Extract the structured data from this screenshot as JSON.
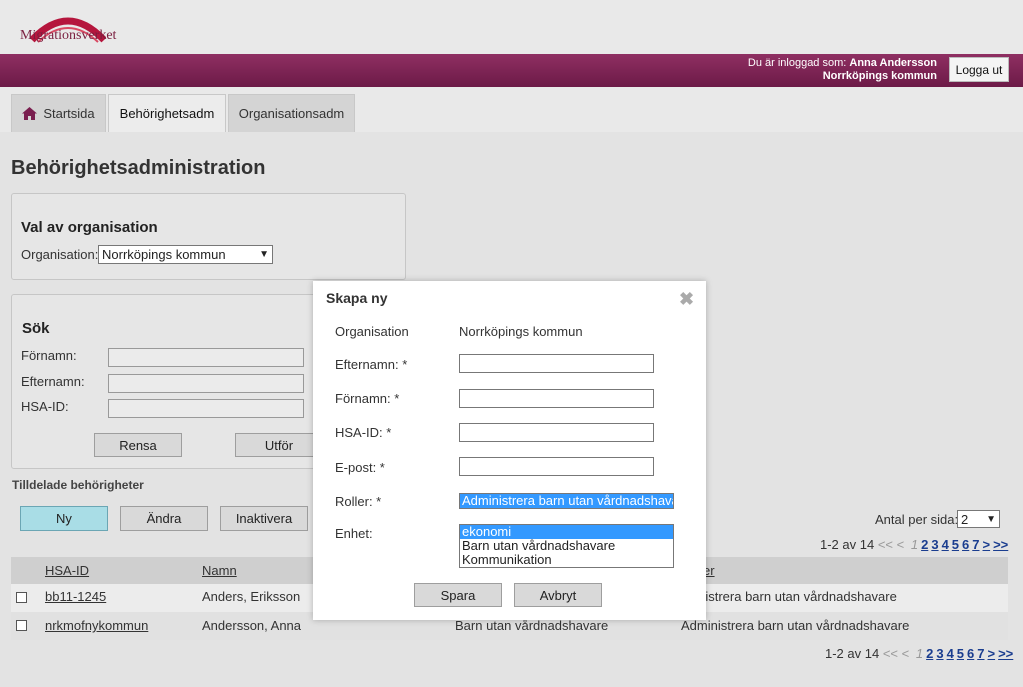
{
  "header": {
    "logo_text": "Migrationsverket",
    "logged_in_prefix": "Du är inloggad som:",
    "user_name": "Anna Andersson",
    "user_org": "Norrköpings kommun",
    "logout_label": "Logga ut"
  },
  "tabs": [
    {
      "label": "Startsida",
      "icon": "home-icon"
    },
    {
      "label": "Behörighetsadm"
    },
    {
      "label": "Organisationsadm"
    }
  ],
  "page_title": "Behörighetsadministration",
  "org_box": {
    "title": "Val av organisation",
    "label": "Organisation:",
    "selected": "Norrköpings kommun"
  },
  "search_box": {
    "title": "Sök",
    "fields": [
      {
        "label": "Förnamn:",
        "value": ""
      },
      {
        "label": "Efternamn:",
        "value": ""
      },
      {
        "label": "HSA-ID:",
        "value": ""
      }
    ],
    "clear_label": "Rensa",
    "execute_label": "Utför"
  },
  "assigned": {
    "title": "Tilldelade behörigheter",
    "new_label": "Ny",
    "edit_label": "Ändra",
    "deactivate_label": "Inaktivera",
    "per_page_label": "Antal per sida:",
    "per_page_value": "2"
  },
  "pager": {
    "range": "1-2 av 14",
    "first": "<<",
    "prev": "<",
    "current": "1",
    "pages": [
      "2",
      "3",
      "4",
      "5",
      "6",
      "7"
    ],
    "next": ">",
    "last": ">>"
  },
  "table": {
    "columns": [
      "HSA-ID",
      "Namn",
      "",
      "er"
    ],
    "rows": [
      {
        "hsa_id": "bb11-1245",
        "name": "Anders, Eriksson",
        "unit": "",
        "role": "ninistrera barn utan vårdnadshavare"
      },
      {
        "hsa_id": "nrkmofnykommun",
        "name": "Andersson, Anna",
        "unit": "Barn utan vårdnadshavare",
        "role": "Administrera barn utan vårdnadshavare"
      }
    ]
  },
  "modal": {
    "title": "Skapa ny",
    "org_label": "Organisation",
    "org_value": "Norrköpings kommun",
    "lastname_label": "Efternamn: *",
    "firstname_label": "Förnamn: *",
    "hsaid_label": "HSA-ID: *",
    "email_label": "E-post: *",
    "roles_label": "Roller: *",
    "roles_selected": "Administrera barn utan vårdnadshavare",
    "unit_label": "Enhet:",
    "unit_options": [
      "ekonomi",
      "Barn utan vårdnadshavare",
      "Kommunikation"
    ],
    "save_label": "Spara",
    "cancel_label": "Avbryt"
  },
  "colors": {
    "brand_bar": "#7a1e4f",
    "primary_button": "#a9dde6",
    "selection": "#3399ff",
    "pager_link": "#1a3d8f"
  }
}
